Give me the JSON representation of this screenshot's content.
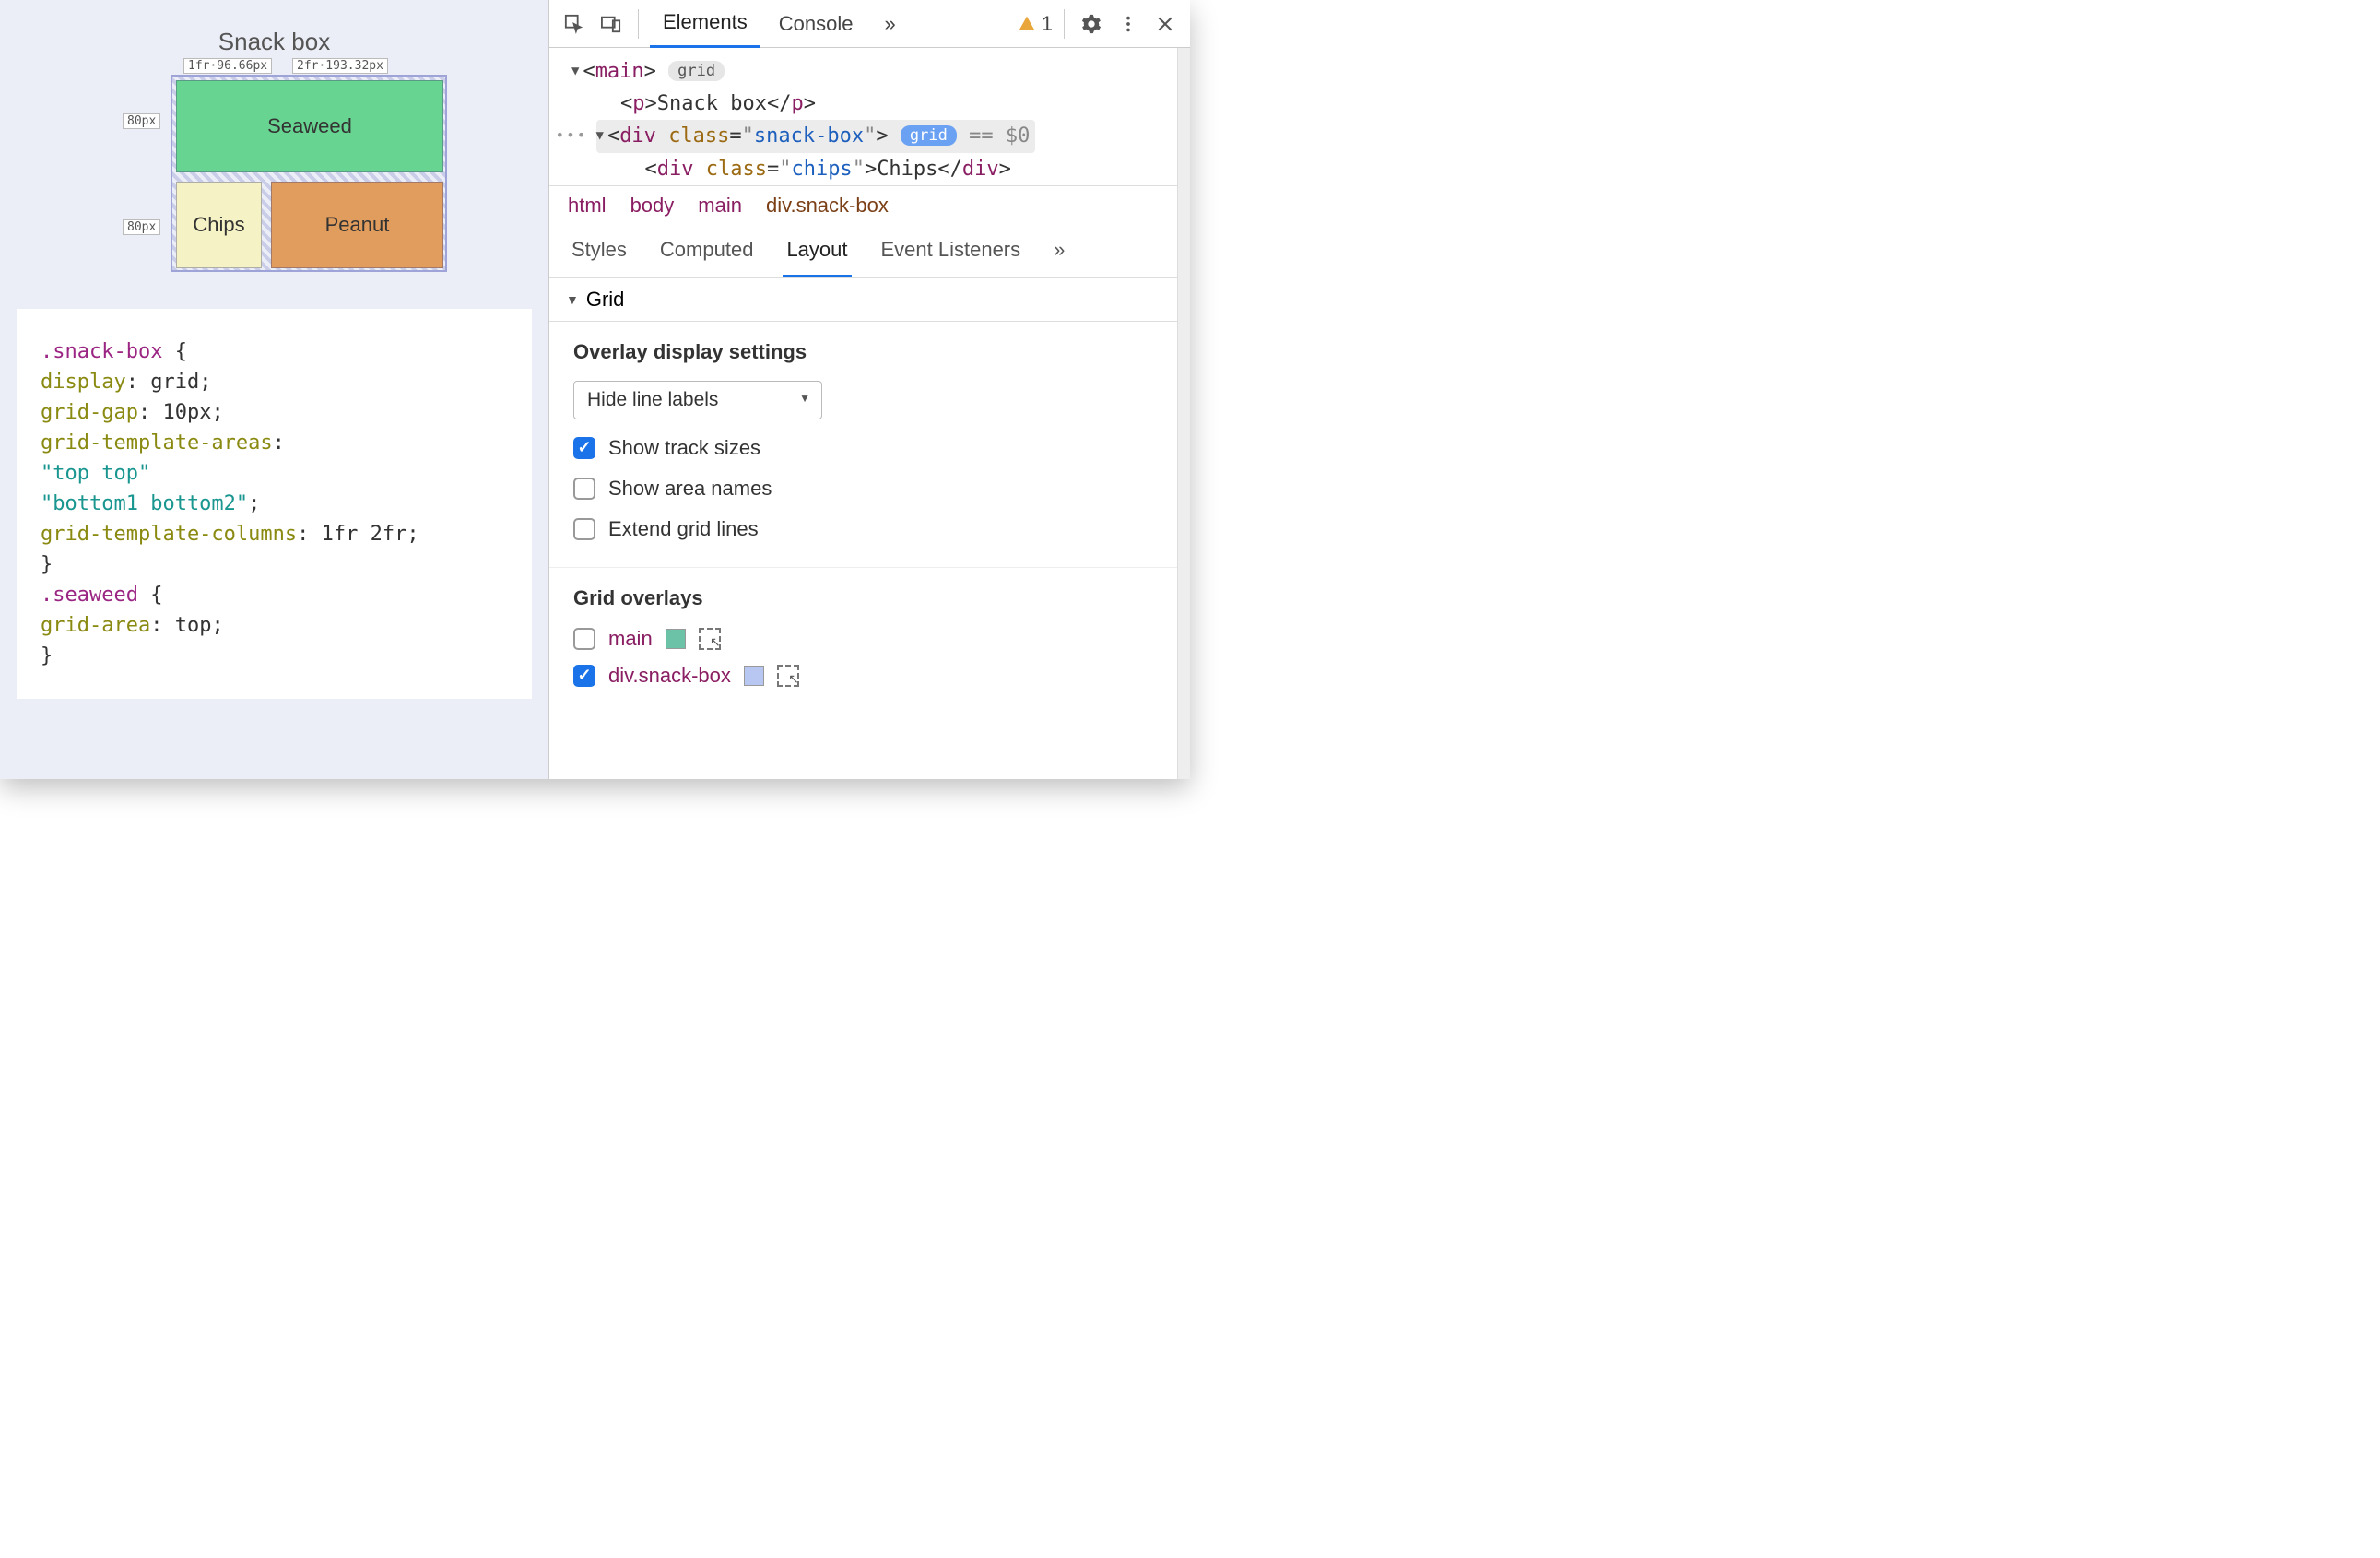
{
  "preview": {
    "title": "Snack box",
    "grid": {
      "col_labels": [
        "1fr·96.66px",
        "2fr·193.32px"
      ],
      "row_labels": [
        "80px",
        "80px"
      ],
      "cells": {
        "seaweed": "Seaweed",
        "chips": "Chips",
        "peanut": "Peanut"
      }
    },
    "code_lines": [
      {
        "segments": [
          {
            "cls": "tok-sel",
            "t": ".snack-box "
          },
          {
            "t": "{"
          }
        ]
      },
      {
        "segments": [
          {
            "t": "  "
          },
          {
            "cls": "tok-prop",
            "t": "display"
          },
          {
            "t": ": grid;"
          }
        ]
      },
      {
        "segments": [
          {
            "t": "  "
          },
          {
            "cls": "tok-prop",
            "t": "grid-gap"
          },
          {
            "t": ": 10px;"
          }
        ]
      },
      {
        "segments": [
          {
            "t": "  "
          },
          {
            "cls": "tok-prop",
            "t": "grid-template-areas"
          },
          {
            "t": ":"
          }
        ]
      },
      {
        "segments": [
          {
            "t": "  "
          },
          {
            "cls": "tok-str",
            "t": "\"top top\""
          }
        ]
      },
      {
        "segments": [
          {
            "t": "  "
          },
          {
            "cls": "tok-str",
            "t": "\"bottom1 bottom2\""
          },
          {
            "t": ";"
          }
        ]
      },
      {
        "segments": [
          {
            "t": "  "
          },
          {
            "cls": "tok-prop",
            "t": "grid-template-columns"
          },
          {
            "t": ": 1fr 2fr;"
          }
        ]
      },
      {
        "segments": [
          {
            "t": "}"
          }
        ]
      },
      {
        "segments": [
          {
            "t": " "
          }
        ]
      },
      {
        "segments": [
          {
            "cls": "tok-sel",
            "t": ".seaweed "
          },
          {
            "t": "{"
          }
        ]
      },
      {
        "segments": [
          {
            "t": "  "
          },
          {
            "cls": "tok-prop",
            "t": "grid-area"
          },
          {
            "t": ": top;"
          }
        ]
      },
      {
        "segments": [
          {
            "t": "}"
          }
        ]
      }
    ]
  },
  "devtools": {
    "tabs": {
      "elements": "Elements",
      "console": "Console",
      "more": "»"
    },
    "warnings_count": "1",
    "dom": {
      "main_tag": "main",
      "main_pill": "grid",
      "p_text": "Snack box",
      "selected_open": "div",
      "selected_class": "snack-box",
      "selected_pill": "grid",
      "selected_suffix": " == $0",
      "child_open": "div",
      "child_class": "chips",
      "child_text": "Chips"
    },
    "breadcrumb": [
      "html",
      "body",
      "main",
      "div.snack-box"
    ],
    "subtabs": {
      "styles": "Styles",
      "computed": "Computed",
      "layout": "Layout",
      "listeners": "Event Listeners",
      "more": "»"
    },
    "section": "Grid",
    "overlay_settings_title": "Overlay display settings",
    "line_labels_select": "Hide line labels",
    "checkboxes": {
      "track_sizes": {
        "label": "Show track sizes",
        "checked": true
      },
      "area_names": {
        "label": "Show area names",
        "checked": false
      },
      "extend_lines": {
        "label": "Extend grid lines",
        "checked": false
      }
    },
    "grid_overlays_title": "Grid overlays",
    "overlays": [
      {
        "name": "main",
        "checked": false,
        "color": "#6bc2a6"
      },
      {
        "name": "div.snack-box",
        "checked": true,
        "color": "#b7c7f2"
      }
    ]
  }
}
